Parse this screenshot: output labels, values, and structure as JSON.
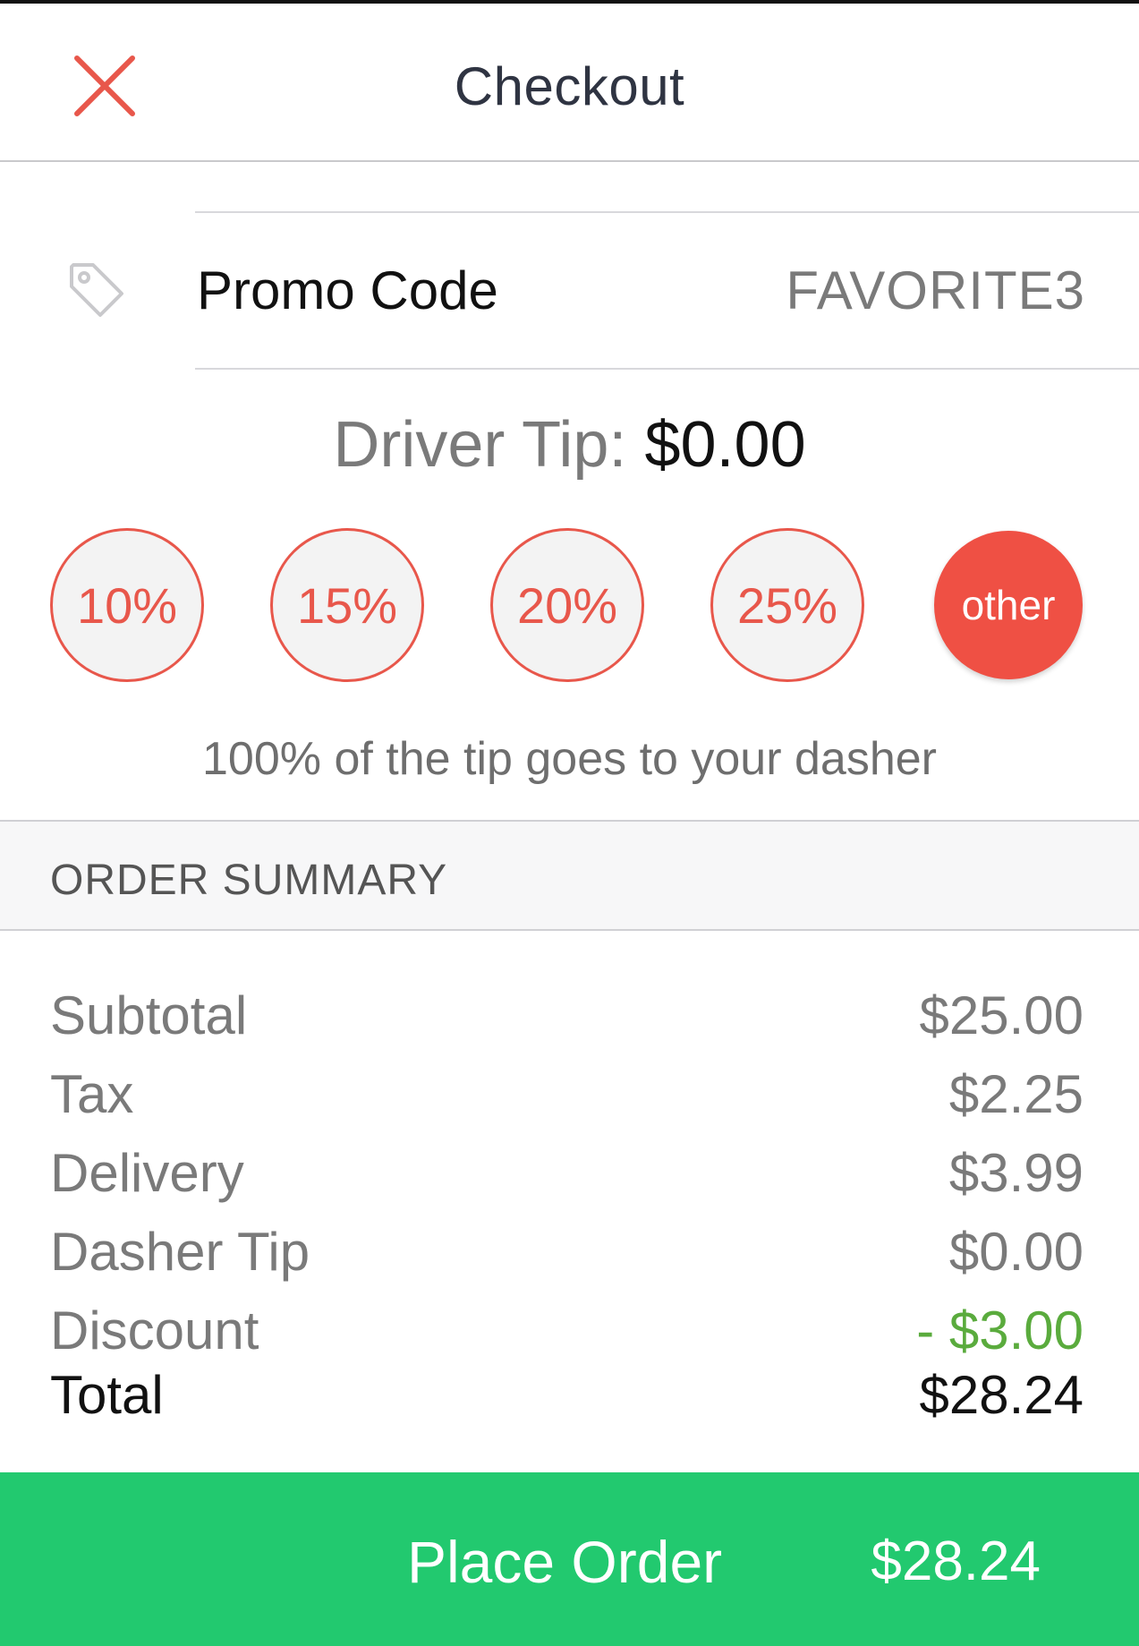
{
  "header": {
    "title": "Checkout",
    "close_icon": "close-icon",
    "close_color": "#e8574b"
  },
  "promo": {
    "icon": "tag-icon",
    "label": "Promo Code",
    "value": "FAVORITE3"
  },
  "tip": {
    "label": "Driver Tip:",
    "amount": "$0.00",
    "options": [
      {
        "label": "10%",
        "selected": false
      },
      {
        "label": "15%",
        "selected": false
      },
      {
        "label": "20%",
        "selected": false
      },
      {
        "label": "25%",
        "selected": false
      },
      {
        "label": "other",
        "selected": true
      }
    ],
    "note": "100% of the tip goes to your dasher",
    "accent_color": "#e8574b"
  },
  "summary": {
    "title": "ORDER SUMMARY",
    "lines": [
      {
        "label": "Subtotal",
        "value": "$25.00"
      },
      {
        "label": "Tax",
        "value": "$2.25"
      },
      {
        "label": "Delivery",
        "value": "$3.99"
      },
      {
        "label": "Dasher Tip",
        "value": "$0.00"
      },
      {
        "label": "Discount",
        "value": "- $3.00"
      }
    ],
    "total": {
      "label": "Total",
      "value": "$28.24"
    },
    "discount_color": "#5aab3d"
  },
  "place_order": {
    "label": "Place Order",
    "price": "$28.24",
    "color": "#22c96f"
  }
}
